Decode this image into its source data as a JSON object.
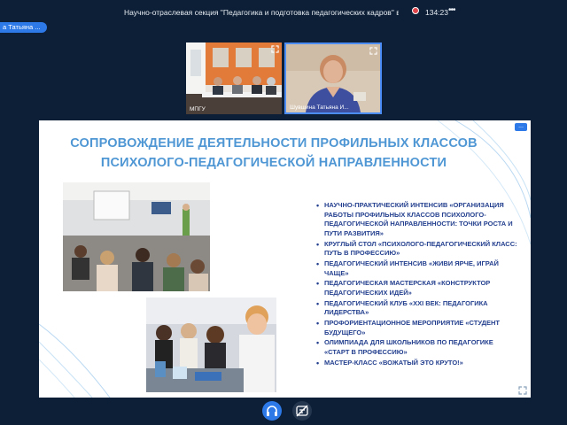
{
  "header": {
    "meeting_title": "Научно-отраслевая секция \"Педагогика и подготовка педагогических кадров\" в рамках ...",
    "timer": "134:23",
    "menu": "•••"
  },
  "participant_chip": "а Татьяна ...",
  "videos": [
    {
      "label": "МПГУ",
      "icon": "expand-icon"
    },
    {
      "label": "Шувшина Татьяна И...",
      "icon": "expand-icon"
    }
  ],
  "slide": {
    "title_line1": "СОПРОВОЖДЕНИЕ ДЕЯТЕЛЬНОСТИ ПРОФИЛЬНЫХ КЛАССОВ",
    "title_line2": "ПСИХОЛОГО-ПЕДАГОГИЧЕСКОЙ НАПРАВЛЕННОСТИ",
    "corner_button": "...",
    "bullets": [
      "НАУЧНО-ПРАКТИЧЕСКИЙ ИНТЕНСИВ «ОРГАНИЗАЦИЯ РАБОТЫ ПРОФИЛЬНЫХ КЛАССОВ ПСИХОЛОГО-ПЕДАГОГИЧЕСКОЙ НАПРАВЛЕННОСТИ: ТОЧКИ РОСТА И ПУТИ РАЗВИТИЯ»",
      "КРУГЛЫЙ СТОЛ «ПСИХОЛОГО-ПЕДАГОГИЧЕСКИЙ КЛАСС: ПУТЬ В ПРОФЕССИЮ»",
      "ПЕДАГОГИЧЕСКИЙ ИНТЕНСИВ «ЖИВИ ЯРЧЕ, ИГРАЙ ЧАЩЕ»",
      "ПЕДАГОГИЧЕСКАЯ МАСТЕРСКАЯ «КОНСТРУКТОР ПЕДАГОГИЧЕСКИХ ИДЕЙ»",
      "ПЕДАГОГИЧЕСКИЙ КЛУБ «XXI ВЕК: ПЕДАГОГИКА ЛИДЕРСТВА»",
      "ПРОФОРИЕНТАЦИОННОЕ МЕРОПРИЯТИЕ «СТУДЕНТ БУДУЩЕГО»",
      "ОЛИМПИАДА ДЛЯ ШКОЛЬНИКОВ ПО ПЕДАГОГИКЕ «СТАРТ В ПРОФЕССИЮ»",
      "МАСТЕР-КЛАСС «ВОЖАТЫЙ ЭТО КРУТО!»"
    ]
  },
  "controls": {
    "audio_icon": "headphones-icon",
    "subtitles_icon": "subtitles-off-icon"
  },
  "colors": {
    "background": "#0d1f36",
    "accent": "#2d79e8",
    "slide_title": "#4f97d4",
    "bullet_text": "#24408f"
  }
}
